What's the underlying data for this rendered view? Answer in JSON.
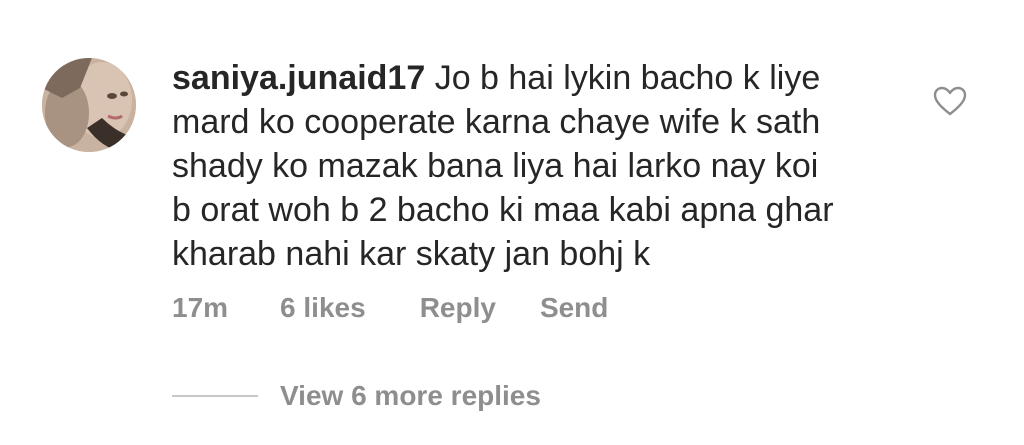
{
  "comment": {
    "username": "saniya.junaid17",
    "text_lines": [
      "Jo b hai lykin bacho k liye",
      "mard ko cooperate karna chaye wife k sath",
      "shady ko mazak bana liya hai larko nay koi",
      "b orat woh b 2 bacho ki maa kabi apna ghar",
      "kharab nahi kar skaty jan bohj k"
    ],
    "time": "17m",
    "likes": "6 likes",
    "reply_label": "Reply",
    "send_label": "Send",
    "like_icon": "heart-outline-icon",
    "view_replies": "View 6 more replies"
  },
  "colors": {
    "text": "#262626",
    "secondary": "#8e8e8e",
    "divider": "#c7c7c7"
  }
}
